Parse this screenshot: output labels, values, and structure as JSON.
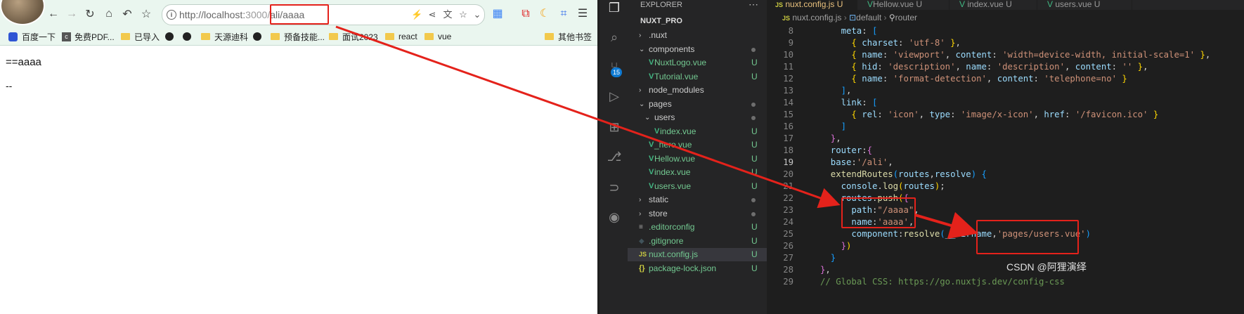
{
  "browser": {
    "url_prefix": "http://localhost:",
    "url_port_path": "3000/",
    "url_route": "ali/aaaa",
    "bookmarks": [
      "百度一下",
      "免费PDF...",
      "已导入",
      "天源迪科",
      "预备技能...",
      "面试2023",
      "react",
      "vue",
      "其他书签"
    ],
    "content_line1": "==aaaa",
    "content_line2": "--",
    "icons": {
      "back": "←",
      "forward": "→",
      "reload": "↻",
      "home": "⌂",
      "undo": "↶",
      "star": "☆",
      "menu": "☰"
    }
  },
  "vscode": {
    "explorer_title": "EXPLORER",
    "project": "NUXT_PRO",
    "scm_badge": "15",
    "tree": [
      {
        "name": ".nuxt",
        "type": "folder",
        "open": false,
        "depth": 0,
        "mark": ""
      },
      {
        "name": "components",
        "type": "folder",
        "open": true,
        "depth": 0,
        "mark": "dot"
      },
      {
        "name": "NuxtLogo.vue",
        "type": "vue",
        "depth": 1,
        "mark": "U"
      },
      {
        "name": "Tutorial.vue",
        "type": "vue",
        "depth": 1,
        "mark": "U"
      },
      {
        "name": "node_modules",
        "type": "folder",
        "open": false,
        "depth": 0,
        "mark": ""
      },
      {
        "name": "pages",
        "type": "folder",
        "open": true,
        "depth": 0,
        "mark": "dot"
      },
      {
        "name": "users",
        "type": "folder",
        "open": true,
        "depth": 1,
        "mark": "dot"
      },
      {
        "name": "index.vue",
        "type": "vue",
        "depth": 2,
        "mark": "U"
      },
      {
        "name": "_hero.vue",
        "type": "vue",
        "depth": 1,
        "mark": "U"
      },
      {
        "name": "Hellow.vue",
        "type": "vue",
        "depth": 1,
        "mark": "U"
      },
      {
        "name": "index.vue",
        "type": "vue",
        "depth": 1,
        "mark": "U"
      },
      {
        "name": "users.vue",
        "type": "vue",
        "depth": 1,
        "mark": "U"
      },
      {
        "name": "static",
        "type": "folder",
        "open": false,
        "depth": 0,
        "mark": "dot"
      },
      {
        "name": "store",
        "type": "folder",
        "open": false,
        "depth": 0,
        "mark": "dot"
      },
      {
        "name": ".editorconfig",
        "type": "config",
        "depth": 0,
        "mark": "U"
      },
      {
        "name": ".gitignore",
        "type": "git",
        "depth": 0,
        "mark": "U"
      },
      {
        "name": "nuxt.config.js",
        "type": "js",
        "depth": 0,
        "mark": "U",
        "selected": true
      },
      {
        "name": "package-lock.json",
        "type": "json",
        "depth": 0,
        "mark": "U"
      }
    ],
    "tabs": [
      {
        "label": "nuxt.config.js U",
        "active": true
      },
      {
        "label": "Hellow.vue U",
        "active": false
      },
      {
        "label": "index.vue U",
        "active": false
      },
      {
        "label": "users.vue U",
        "active": false
      }
    ],
    "breadcrumb": [
      "nuxt.config.js",
      "default",
      "router"
    ],
    "current_line": 19,
    "code": [
      {
        "n": 8,
        "indent": 4,
        "html": "<span class='p'>meta</span>: <span class='b'>[</span>"
      },
      {
        "n": 9,
        "indent": 6,
        "html": "<span class='y'>{</span> <span class='p'>charset</span>: <span class='s'>'utf-8'</span> <span class='y'>}</span>,"
      },
      {
        "n": 10,
        "indent": 6,
        "html": "<span class='y'>{</span> <span class='p'>name</span>: <span class='s'>'viewport'</span>, <span class='p'>content</span>: <span class='s'>'width=device-width, initial-scale=1'</span> <span class='y'>}</span>,"
      },
      {
        "n": 11,
        "indent": 6,
        "html": "<span class='y'>{</span> <span class='p'>hid</span>: <span class='s'>'description'</span>, <span class='p'>name</span>: <span class='s'>'description'</span>, <span class='p'>content</span>: <span class='s'>''</span> <span class='y'>}</span>,"
      },
      {
        "n": 12,
        "indent": 6,
        "html": "<span class='y'>{</span> <span class='p'>name</span>: <span class='s'>'format-detection'</span>, <span class='p'>content</span>: <span class='s'>'telephone=no'</span> <span class='y'>}</span>"
      },
      {
        "n": 13,
        "indent": 4,
        "html": "<span class='b'>]</span>,"
      },
      {
        "n": 14,
        "indent": 4,
        "html": "<span class='p'>link</span>: <span class='b'>[</span>"
      },
      {
        "n": 15,
        "indent": 6,
        "html": "<span class='y'>{</span> <span class='p'>rel</span>: <span class='s'>'icon'</span>, <span class='p'>type</span>: <span class='s'>'image/x-icon'</span>, <span class='p'>href</span>: <span class='s'>'/favicon.ico'</span> <span class='y'>}</span>"
      },
      {
        "n": 16,
        "indent": 4,
        "html": "<span class='b'>]</span>"
      },
      {
        "n": 17,
        "indent": 2,
        "html": "<span class='m'>}</span>,"
      },
      {
        "n": 18,
        "indent": 2,
        "html": "<span class='p'>router</span>:<span class='m'>{</span>"
      },
      {
        "n": 19,
        "indent": 2,
        "html": "<span class='p'>base</span>:<span class='s'>'/ali'</span>,"
      },
      {
        "n": 20,
        "indent": 2,
        "html": "<span class='f'>extendRoutes</span><span class='b'>(</span><span class='p'>routes</span>,<span class='p'>resolve</span><span class='b'>)</span> <span class='b'>{</span>"
      },
      {
        "n": 21,
        "indent": 4,
        "html": "<span class='p'>console</span>.<span class='f'>log</span><span class='y'>(</span><span class='p'>routes</span><span class='y'>)</span>;"
      },
      {
        "n": 22,
        "indent": 4,
        "html": "<span class='p'>routes</span>.<span class='f'>push</span><span class='y'>(</span><span class='m'>{</span>"
      },
      {
        "n": 23,
        "indent": 6,
        "html": "<span class='p'>path</span>:<span class='s'>\"/aaaa\"</span>,"
      },
      {
        "n": 24,
        "indent": 6,
        "html": "<span class='p'>name</span>:<span class='s'>'aaaa'</span>,"
      },
      {
        "n": 25,
        "indent": 6,
        "html": "<span class='p'>component</span>:<span class='f'>resolve</span><span class='b'>(</span><span class='p'>__dirname</span>,<span class='s'>'pages/users.vue'</span><span class='b'>)</span>"
      },
      {
        "n": 26,
        "indent": 4,
        "html": "<span class='m'>}</span><span class='y'>)</span>"
      },
      {
        "n": 27,
        "indent": 2,
        "html": "<span class='b'>}</span>"
      },
      {
        "n": 28,
        "indent": 0,
        "html": "<span class='m'>}</span>,"
      },
      {
        "n": 29,
        "indent": 0,
        "html": "<span class='c'>// Global CSS: https://go.nuxtjs.dev/config-css</span>"
      }
    ]
  },
  "watermark": "CSDN @阿狸演绎",
  "colors": {
    "annotation_red": "#e4221b",
    "vue_green": "#41b883",
    "untracked_green": "#73c991"
  }
}
